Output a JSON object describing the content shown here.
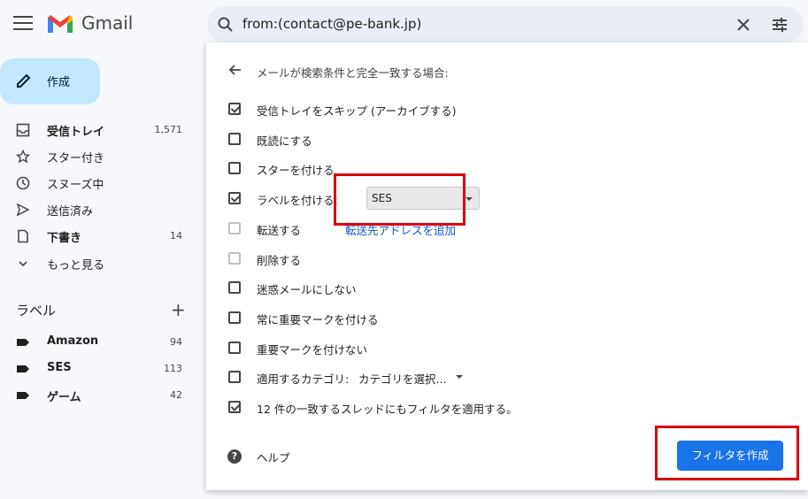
{
  "app": {
    "brand": "Gmail"
  },
  "search": {
    "query": "from:(contact@pe-bank.jp)"
  },
  "sidebar": {
    "compose_label": "作成",
    "items": [
      {
        "label": "受信トレイ",
        "count": "1,571",
        "bold": true,
        "icon": "inbox-icon"
      },
      {
        "label": "スター付き",
        "count": "",
        "bold": false,
        "icon": "star-icon"
      },
      {
        "label": "スヌーズ中",
        "count": "",
        "bold": false,
        "icon": "clock-icon"
      },
      {
        "label": "送信済み",
        "count": "",
        "bold": false,
        "icon": "send-icon"
      },
      {
        "label": "下書き",
        "count": "14",
        "bold": true,
        "icon": "draft-icon"
      },
      {
        "label": "もっと見る",
        "count": "",
        "bold": false,
        "icon": "chevron-down-icon"
      }
    ],
    "labels_heading": "ラベル",
    "labels": [
      {
        "label": "Amazon",
        "count": "94"
      },
      {
        "label": "SES",
        "count": "113"
      },
      {
        "label": "ゲーム",
        "count": "42"
      }
    ]
  },
  "filter": {
    "title": "メールが検索条件と完全一致する場合:",
    "options": [
      {
        "label": "受信トレイをスキップ (アーカイブする)",
        "checked": true
      },
      {
        "label": "既読にする",
        "checked": false
      },
      {
        "label": "スターを付ける",
        "checked": false
      },
      {
        "label": "ラベルを付ける:",
        "checked": true
      },
      {
        "label": "転送する",
        "checked": false
      },
      {
        "label": "削除する",
        "checked": false
      },
      {
        "label": "迷惑メールにしない",
        "checked": false
      },
      {
        "label": "常に重要マークを付ける",
        "checked": false
      },
      {
        "label": "重要マークを付けない",
        "checked": false
      },
      {
        "label": "適用するカテゴリ:",
        "checked": false
      },
      {
        "label": "12 件の一致するスレッドにもフィルタを適用する。",
        "checked": true
      }
    ],
    "label_select_value": "SES",
    "forward_link": "転送先アドレスを追加",
    "category_select_value": "カテゴリを選択...",
    "help_label": "ヘルプ",
    "create_button": "フィルタを作成"
  },
  "colors": {
    "accent": "#1a73e8",
    "compose_bg": "#c2e7ff",
    "highlight": "#d9000f"
  }
}
